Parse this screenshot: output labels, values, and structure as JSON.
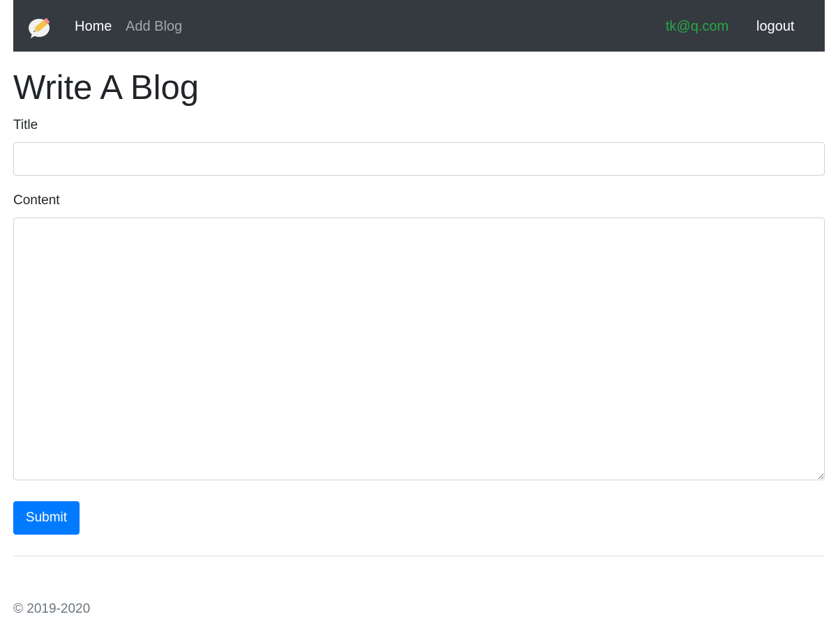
{
  "navbar": {
    "logo_icon": "blog-pencil-logo-icon",
    "links": [
      {
        "label": "Home"
      },
      {
        "label": "Add Blog"
      }
    ],
    "user_email": "tk@q.com",
    "logout_label": "logout"
  },
  "page": {
    "title": "Write A Blog"
  },
  "form": {
    "title_label": "Title",
    "title_value": "",
    "content_label": "Content",
    "content_value": "",
    "submit_label": "Submit"
  },
  "footer": {
    "copyright": "© 2019-2020"
  },
  "colors": {
    "navbar_bg": "#343a40",
    "user_email": "#28a745",
    "primary_button": "#007bff"
  }
}
